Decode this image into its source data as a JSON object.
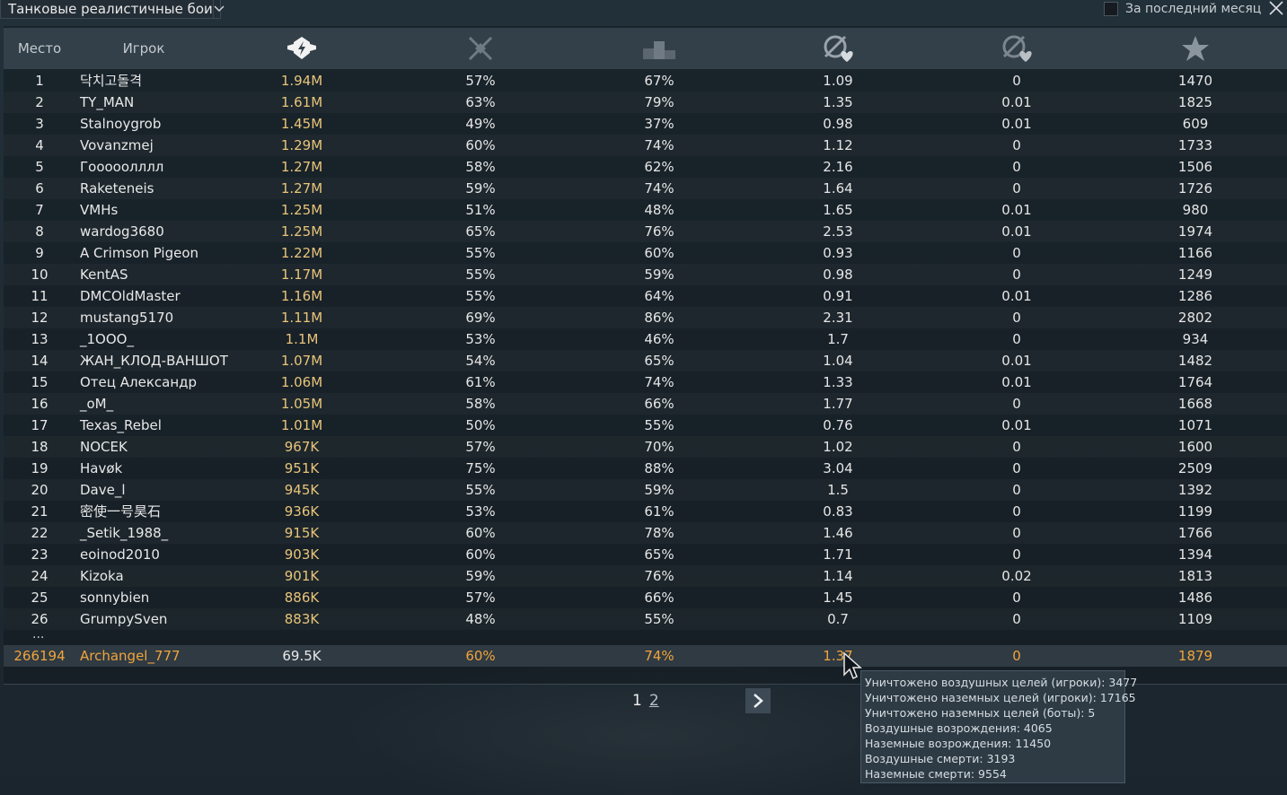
{
  "topbar": {
    "mode_label": "Танковые реалистичные бои",
    "period_label": "За последний месяц"
  },
  "header": {
    "place_label": "Место",
    "player_label": "Игрок"
  },
  "rows": [
    {
      "rank": "1",
      "name": "닥치고돌격",
      "c1": "1.94M",
      "c2": "57%",
      "c3": "67%",
      "c4": "1.09",
      "c5": "0",
      "c6": "1470"
    },
    {
      "rank": "2",
      "name": "TY_MAN",
      "c1": "1.61M",
      "c2": "63%",
      "c3": "79%",
      "c4": "1.35",
      "c5": "0.01",
      "c6": "1825"
    },
    {
      "rank": "3",
      "name": "Stalnoygrob",
      "c1": "1.45M",
      "c2": "49%",
      "c3": "37%",
      "c4": "0.98",
      "c5": "0.01",
      "c6": "609"
    },
    {
      "rank": "4",
      "name": "Vovanzmej",
      "c1": "1.29M",
      "c2": "60%",
      "c3": "74%",
      "c4": "1.12",
      "c5": "0",
      "c6": "1733"
    },
    {
      "rank": "5",
      "name": "Гооооолллл",
      "c1": "1.27M",
      "c2": "58%",
      "c3": "62%",
      "c4": "2.16",
      "c5": "0",
      "c6": "1506"
    },
    {
      "rank": "6",
      "name": "Raketeneis",
      "c1": "1.27M",
      "c2": "59%",
      "c3": "74%",
      "c4": "1.64",
      "c5": "0",
      "c6": "1726"
    },
    {
      "rank": "7",
      "name": "VMHs",
      "c1": "1.25M",
      "c2": "51%",
      "c3": "48%",
      "c4": "1.65",
      "c5": "0.01",
      "c6": "980"
    },
    {
      "rank": "8",
      "name": "wardog3680",
      "c1": "1.25M",
      "c2": "65%",
      "c3": "76%",
      "c4": "2.53",
      "c5": "0.01",
      "c6": "1974"
    },
    {
      "rank": "9",
      "name": "A Crimson Pigeon",
      "c1": "1.22M",
      "c2": "55%",
      "c3": "60%",
      "c4": "0.93",
      "c5": "0",
      "c6": "1166"
    },
    {
      "rank": "10",
      "name": "KentAS",
      "c1": "1.17M",
      "c2": "55%",
      "c3": "59%",
      "c4": "0.98",
      "c5": "0",
      "c6": "1249"
    },
    {
      "rank": "11",
      "name": "DMCOldMaster",
      "c1": "1.16M",
      "c2": "55%",
      "c3": "64%",
      "c4": "0.91",
      "c5": "0.01",
      "c6": "1286"
    },
    {
      "rank": "12",
      "name": "mustang5170",
      "c1": "1.11M",
      "c2": "69%",
      "c3": "86%",
      "c4": "2.31",
      "c5": "0",
      "c6": "2802"
    },
    {
      "rank": "13",
      "name": "_1OOO_",
      "c1": "1.1M",
      "c2": "53%",
      "c3": "46%",
      "c4": "1.7",
      "c5": "0",
      "c6": "934"
    },
    {
      "rank": "14",
      "name": "ЖАН_КЛОД-ВАНШОТ",
      "c1": "1.07M",
      "c2": "54%",
      "c3": "65%",
      "c4": "1.04",
      "c5": "0.01",
      "c6": "1482"
    },
    {
      "rank": "15",
      "name": "Отец Александр",
      "c1": "1.06M",
      "c2": "61%",
      "c3": "74%",
      "c4": "1.33",
      "c5": "0.01",
      "c6": "1764"
    },
    {
      "rank": "16",
      "name": "_oM_",
      "c1": "1.05M",
      "c2": "58%",
      "c3": "66%",
      "c4": "1.77",
      "c5": "0",
      "c6": "1668"
    },
    {
      "rank": "17",
      "name": "Texas_Rebel",
      "c1": "1.01M",
      "c2": "50%",
      "c3": "55%",
      "c4": "0.76",
      "c5": "0.01",
      "c6": "1071"
    },
    {
      "rank": "18",
      "name": "NOCEK",
      "c1": "967K",
      "c2": "57%",
      "c3": "70%",
      "c4": "1.02",
      "c5": "0",
      "c6": "1600"
    },
    {
      "rank": "19",
      "name": "Havøk",
      "c1": "951K",
      "c2": "75%",
      "c3": "88%",
      "c4": "3.04",
      "c5": "0",
      "c6": "2509"
    },
    {
      "rank": "20",
      "name": "Dave_l",
      "c1": "945K",
      "c2": "55%",
      "c3": "59%",
      "c4": "1.5",
      "c5": "0",
      "c6": "1392"
    },
    {
      "rank": "21",
      "name": "密使一号昊石",
      "c1": "936K",
      "c2": "53%",
      "c3": "61%",
      "c4": "0.83",
      "c5": "0",
      "c6": "1199"
    },
    {
      "rank": "22",
      "name": "_Setik_1988_",
      "c1": "915K",
      "c2": "60%",
      "c3": "78%",
      "c4": "1.46",
      "c5": "0",
      "c6": "1766"
    },
    {
      "rank": "23",
      "name": "eoinod2010",
      "c1": "903K",
      "c2": "60%",
      "c3": "65%",
      "c4": "1.71",
      "c5": "0",
      "c6": "1394"
    },
    {
      "rank": "24",
      "name": "Kizoka",
      "c1": "901K",
      "c2": "59%",
      "c3": "76%",
      "c4": "1.14",
      "c5": "0.02",
      "c6": "1813"
    },
    {
      "rank": "25",
      "name": "sonnybien",
      "c1": "886K",
      "c2": "57%",
      "c3": "66%",
      "c4": "1.45",
      "c5": "0",
      "c6": "1486"
    },
    {
      "rank": "26",
      "name": "GrumpySven",
      "c1": "883K",
      "c2": "48%",
      "c3": "55%",
      "c4": "0.7",
      "c5": "0",
      "c6": "1109"
    }
  ],
  "ellipsis": "...",
  "me": {
    "rank": "266194",
    "name": "Archangel_777",
    "c1": "69.5K",
    "c2": "60%",
    "c3": "74%",
    "c4": "1.37",
    "c5": "0",
    "c6": "1879"
  },
  "pager": {
    "page1": "1",
    "page2": "2"
  },
  "tooltip": {
    "lines": [
      "Уничтожено воздушных целей (игроки): 3477",
      "Уничтожено наземных целей (игроки): 17165",
      "Уничтожено наземных целей (боты): 5",
      "Воздушные возрождения: 4065",
      "Наземные возрождения: 11450",
      "Воздушные смерти: 3193",
      "Наземные смерти: 9554"
    ]
  },
  "colors": {
    "accent_gold": "#e8c47a",
    "player_orange": "#f0a43c",
    "header_bg": "#334049"
  },
  "icons": {
    "col1": "rating-emblem-icon",
    "col2": "crossed-swords-icon",
    "col3": "podium-icon",
    "col4": "ground-kills-heart-icon",
    "col5": "air-kills-heart-icon",
    "col6": "star-icon"
  }
}
